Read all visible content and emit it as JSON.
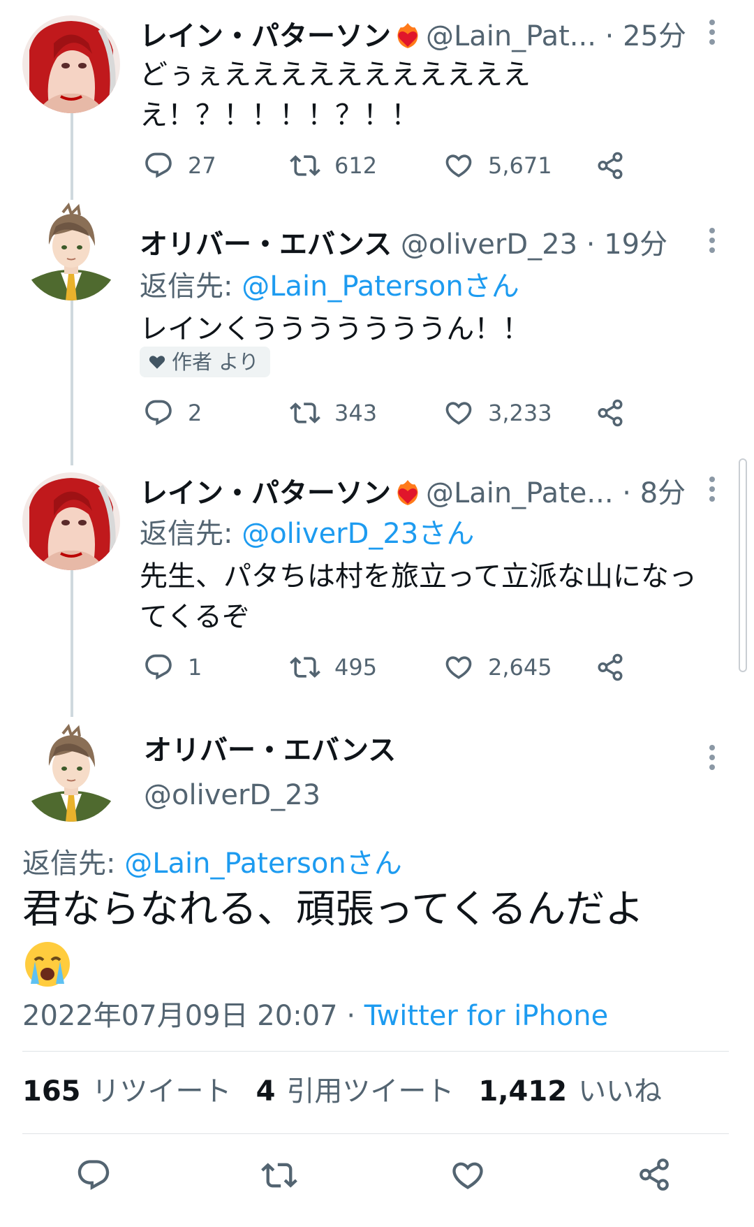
{
  "tweets": [
    {
      "display_name": "レイン・パターソン",
      "handle": "@Lain_Pat...",
      "time": "· 25分",
      "has_fire_emoji": true,
      "text_lines": [
        "どぅぇえええええええええええ",
        "え！？！！！！？！！"
      ],
      "replies": "27",
      "retweets": "612",
      "likes": "5,671"
    },
    {
      "display_name": "オリバー・エバンス",
      "handle": "@oliverD_23",
      "time": "· 19分",
      "reply_prefix": "返信先:",
      "reply_target": "@Lain_Patersonさん",
      "text_lines": [
        "レインくうううううううん！！"
      ],
      "badge": "作者 より",
      "replies": "2",
      "retweets": "343",
      "likes": "3,233"
    },
    {
      "display_name": "レイン・パターソン",
      "handle": "@Lain_Pate...",
      "time": "· 8分",
      "has_fire_emoji": true,
      "reply_prefix": "返信先:",
      "reply_target": "@oliverD_23さん",
      "text_lines": [
        "先生、パタちは村を旅立って立派な山になっ",
        "てくるぞ"
      ],
      "replies": "1",
      "retweets": "495",
      "likes": "2,645"
    }
  ],
  "main_tweet": {
    "display_name": "オリバー・エバンス",
    "handle": "@oliverD_23",
    "reply_prefix": "返信先:",
    "reply_target": "@Lain_Patersonさん",
    "text": "君ならなれる、頑張ってくるんだよ",
    "emoji": "loudly-crying-face",
    "timestamp": "2022年07月09日 20:07",
    "separator": "·",
    "source": "Twitter for iPhone",
    "stats": {
      "retweets_count": "165",
      "retweets_label": "リツイート",
      "quotes_count": "4",
      "quotes_label": "引用ツイート",
      "likes_count": "1,412",
      "likes_label": "いいね"
    }
  },
  "colors": {
    "text_primary": "#0f1419",
    "text_secondary": "#536471",
    "link": "#1d9bf0",
    "thread_line": "#cfd9de"
  },
  "icons": [
    "reply-icon",
    "retweet-icon",
    "like-icon",
    "share-icon",
    "more-icon",
    "heart-badge-icon",
    "fire-heart-emoji",
    "crying-face-emoji"
  ]
}
